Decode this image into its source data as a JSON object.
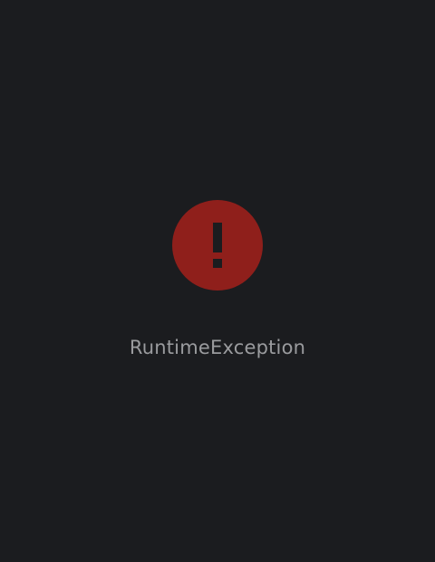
{
  "error": {
    "icon": "exclamation-circle-icon",
    "message": "RuntimeException"
  },
  "colors": {
    "background": "#1b1c1f",
    "icon_fill": "#8f1f1b",
    "icon_glyph": "#1b1c1f",
    "message_text": "#9a9b9e"
  }
}
